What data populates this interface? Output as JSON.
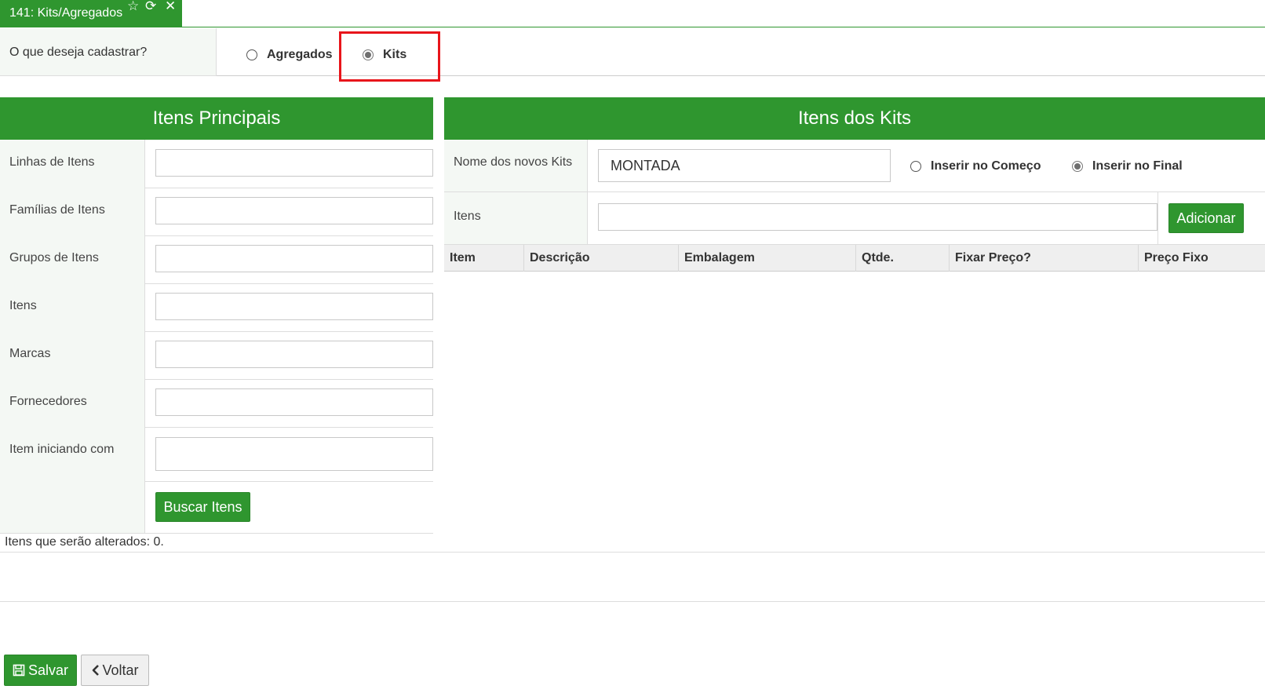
{
  "tab": {
    "title": "141: Kits/Agregados",
    "icons": [
      "star-outline-icon",
      "refresh-icon",
      "close-icon"
    ]
  },
  "question": {
    "label": "O que deseja cadastrar?",
    "options": [
      {
        "label": "Agregados",
        "selected": false
      },
      {
        "label": "Kits",
        "selected": true
      }
    ]
  },
  "left_panel": {
    "title": "Itens Principais",
    "fields": [
      {
        "label": "Linhas de Itens",
        "value": ""
      },
      {
        "label": "Famílias de Itens",
        "value": ""
      },
      {
        "label": "Grupos de Itens",
        "value": ""
      },
      {
        "label": "Itens",
        "value": ""
      },
      {
        "label": "Marcas",
        "value": ""
      },
      {
        "label": "Fornecedores",
        "value": ""
      },
      {
        "label": "Item iniciando com",
        "value": ""
      }
    ],
    "search_button": "Buscar Itens",
    "status": "Itens que serão alterados: 0."
  },
  "right_panel": {
    "title": "Itens dos Kits",
    "kit_name_label": "Nome dos novos Kits",
    "kit_name_value": "MONTADA",
    "insert_options": [
      {
        "label": "Inserir no Começo",
        "selected": false
      },
      {
        "label": "Inserir no Final",
        "selected": true
      }
    ],
    "items_label": "Itens",
    "items_value": "",
    "add_button": "Adicionar",
    "table_headers": [
      "Item",
      "Descrição",
      "Embalagem",
      "Qtde.",
      "Fixar Preço?",
      "Preço Fixo"
    ]
  },
  "footer": {
    "save_label": "Salvar",
    "back_label": "Voltar"
  },
  "colors": {
    "primary_green": "#2f962f",
    "highlight_red": "#e8151b"
  }
}
